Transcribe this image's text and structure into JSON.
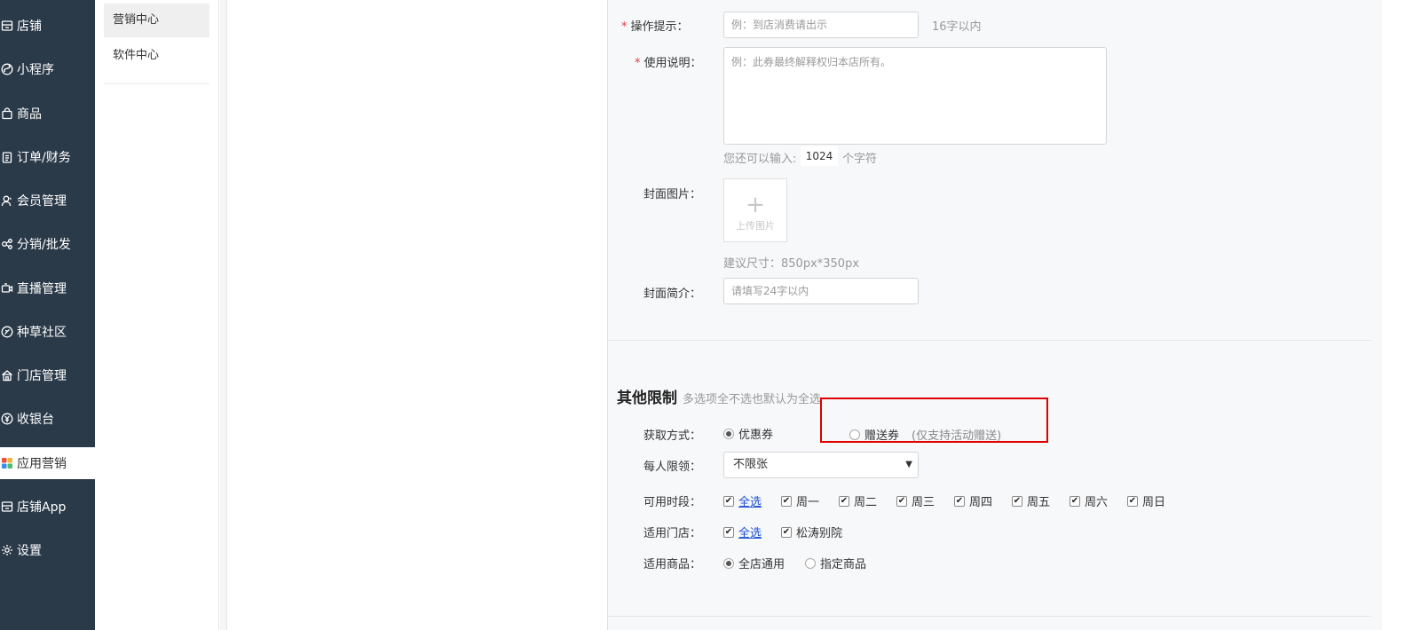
{
  "sidebar": {
    "items": [
      {
        "label": "店铺",
        "icon": "store-icon"
      },
      {
        "label": "小程序",
        "icon": "miniprogram-icon"
      },
      {
        "label": "商品",
        "icon": "goods-bag-icon"
      },
      {
        "label": "订单/财务",
        "icon": "order-clipboard-icon"
      },
      {
        "label": "会员管理",
        "icon": "member-icon"
      },
      {
        "label": "分销/批发",
        "icon": "distribution-icon"
      },
      {
        "label": "直播管理",
        "icon": "live-video-icon"
      },
      {
        "label": "种草社区",
        "icon": "community-icon"
      },
      {
        "label": "门店管理",
        "icon": "shop-home-icon"
      },
      {
        "label": "收银台",
        "icon": "cashier-yen-icon"
      },
      {
        "label": "应用营销",
        "icon": "apps-grid-icon",
        "active": true
      },
      {
        "label": "店铺App",
        "icon": "store-app-icon"
      },
      {
        "label": "设置",
        "icon": "gear-icon"
      }
    ]
  },
  "subnav": {
    "items": [
      {
        "label": "营销中心",
        "active": true
      },
      {
        "label": "软件中心"
      }
    ]
  },
  "form": {
    "operation_tip": {
      "label": "操作提示：",
      "placeholder": "例：到店消费请出示",
      "hint": "16字以内"
    },
    "usage": {
      "label": "使用说明：",
      "placeholder": "例：此券最终解释权归本店所有。",
      "remaining_prefix": "您还可以输入:",
      "remaining_count": "1024",
      "remaining_suffix": "个字符"
    },
    "cover_image": {
      "label": "封面图片：",
      "upload_text": "上传图片",
      "size_hint": "建议尺寸：850px*350px"
    },
    "cover_intro": {
      "label": "封面简介：",
      "placeholder": "请填写24字以内"
    }
  },
  "limits": {
    "title": "其他限制",
    "subtitle": "多选项全不选也默认为全选",
    "acquire": {
      "label": "获取方式：",
      "option1": "优惠券",
      "option2": "赠送券",
      "option2_note": "(仅支持活动赠送)"
    },
    "per_person": {
      "label": "每人限领：",
      "selected": "不限张"
    },
    "time_slots": {
      "label": "可用时段：",
      "all": "全选",
      "days": [
        "周一",
        "周二",
        "周三",
        "周四",
        "周五",
        "周六",
        "周日"
      ]
    },
    "stores": {
      "label": "适用门店：",
      "all": "全选",
      "store": "松涛别院"
    },
    "goods": {
      "label": "适用商品：",
      "option1": "全店通用",
      "option2": "指定商品"
    }
  },
  "colors": {
    "sidebar_bg": "#2b3a49",
    "highlight": "#e00000",
    "link": "#1a4fd6"
  }
}
